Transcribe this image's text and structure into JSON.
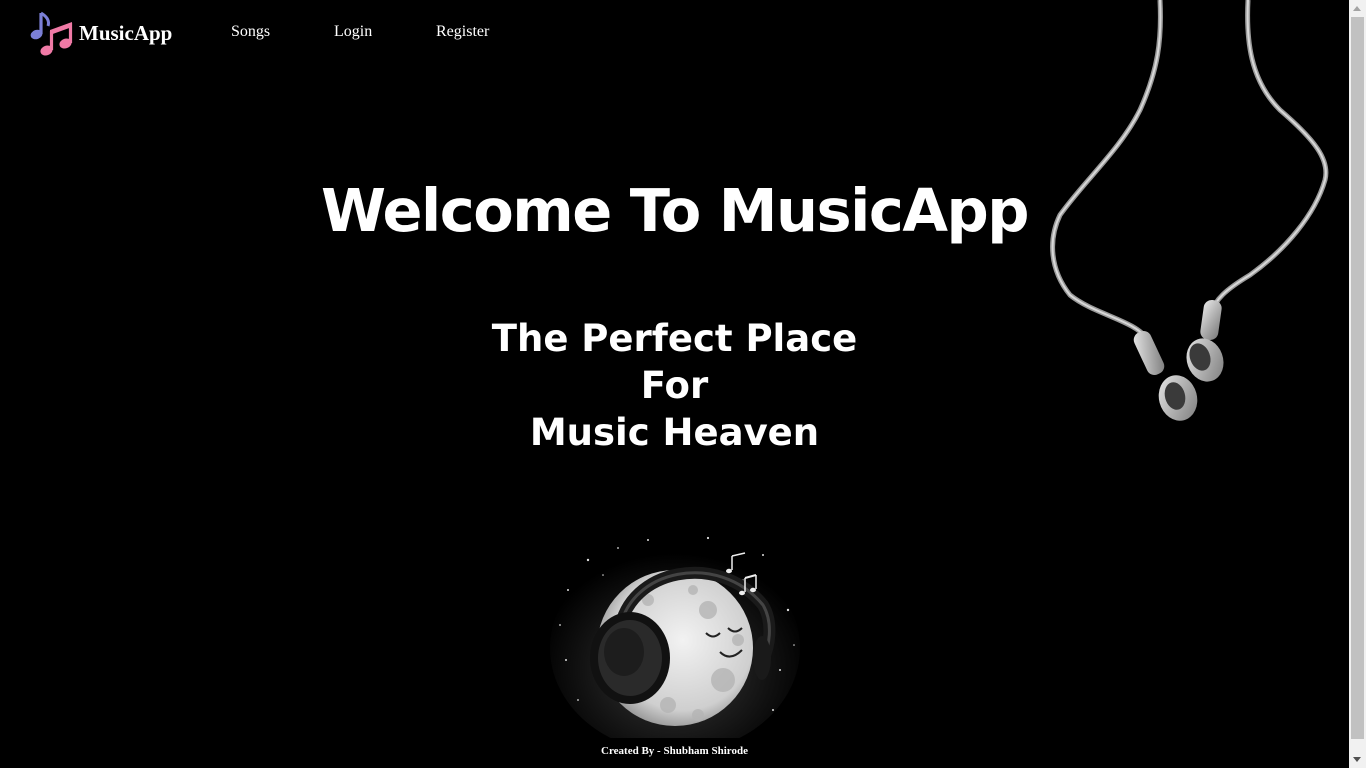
{
  "navbar": {
    "brand_name": "MusicApp",
    "brand_icon": "music-notes-icon",
    "links": [
      {
        "label": "Songs"
      },
      {
        "label": "Login"
      },
      {
        "label": "Register"
      }
    ]
  },
  "hero": {
    "title": "Welcome To MusicApp",
    "tagline_lines": [
      "The Perfect Place",
      "For",
      "Music Heaven"
    ]
  },
  "footer": {
    "credit": "Created By - Shubham Shirode"
  },
  "colors": {
    "background": "#000000",
    "text": "#ffffff",
    "brand_note_purple": "#7b7fd6",
    "brand_note_pink": "#f07aa6"
  }
}
